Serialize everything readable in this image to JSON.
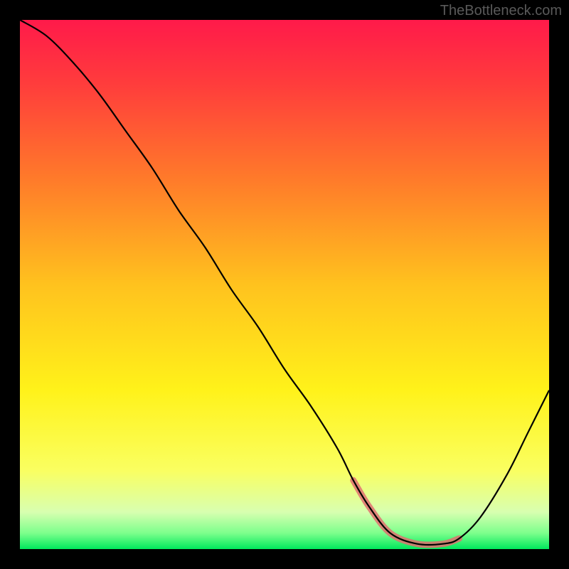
{
  "attribution": "TheBottleneck.com",
  "chart_data": {
    "type": "line",
    "title": "",
    "xlabel": "",
    "ylabel": "",
    "x_range": [
      0,
      100
    ],
    "y_range": [
      0,
      100
    ],
    "series": [
      {
        "name": "bottleneck-curve",
        "x": [
          0,
          5,
          10,
          15,
          20,
          25,
          30,
          35,
          40,
          45,
          50,
          55,
          60,
          63,
          66,
          70,
          75,
          80,
          83,
          87,
          92,
          96,
          100
        ],
        "values": [
          100,
          97,
          92,
          86,
          79,
          72,
          64,
          57,
          49,
          42,
          34,
          27,
          19,
          13,
          8,
          3,
          1,
          1,
          2,
          6,
          14,
          22,
          30
        ]
      }
    ],
    "highlight_region": {
      "x_start": 63,
      "x_end": 83,
      "color": "#e07070",
      "description": "optimal-zone-near-minimum"
    },
    "background_gradient": {
      "stops": [
        {
          "offset": 0.0,
          "color": "#ff1a4a"
        },
        {
          "offset": 0.12,
          "color": "#ff3c3c"
        },
        {
          "offset": 0.3,
          "color": "#ff7a2a"
        },
        {
          "offset": 0.5,
          "color": "#ffc21e"
        },
        {
          "offset": 0.7,
          "color": "#fff21a"
        },
        {
          "offset": 0.85,
          "color": "#faff60"
        },
        {
          "offset": 0.93,
          "color": "#d8ffb0"
        },
        {
          "offset": 0.97,
          "color": "#7cff8c"
        },
        {
          "offset": 1.0,
          "color": "#00e85c"
        }
      ]
    }
  }
}
